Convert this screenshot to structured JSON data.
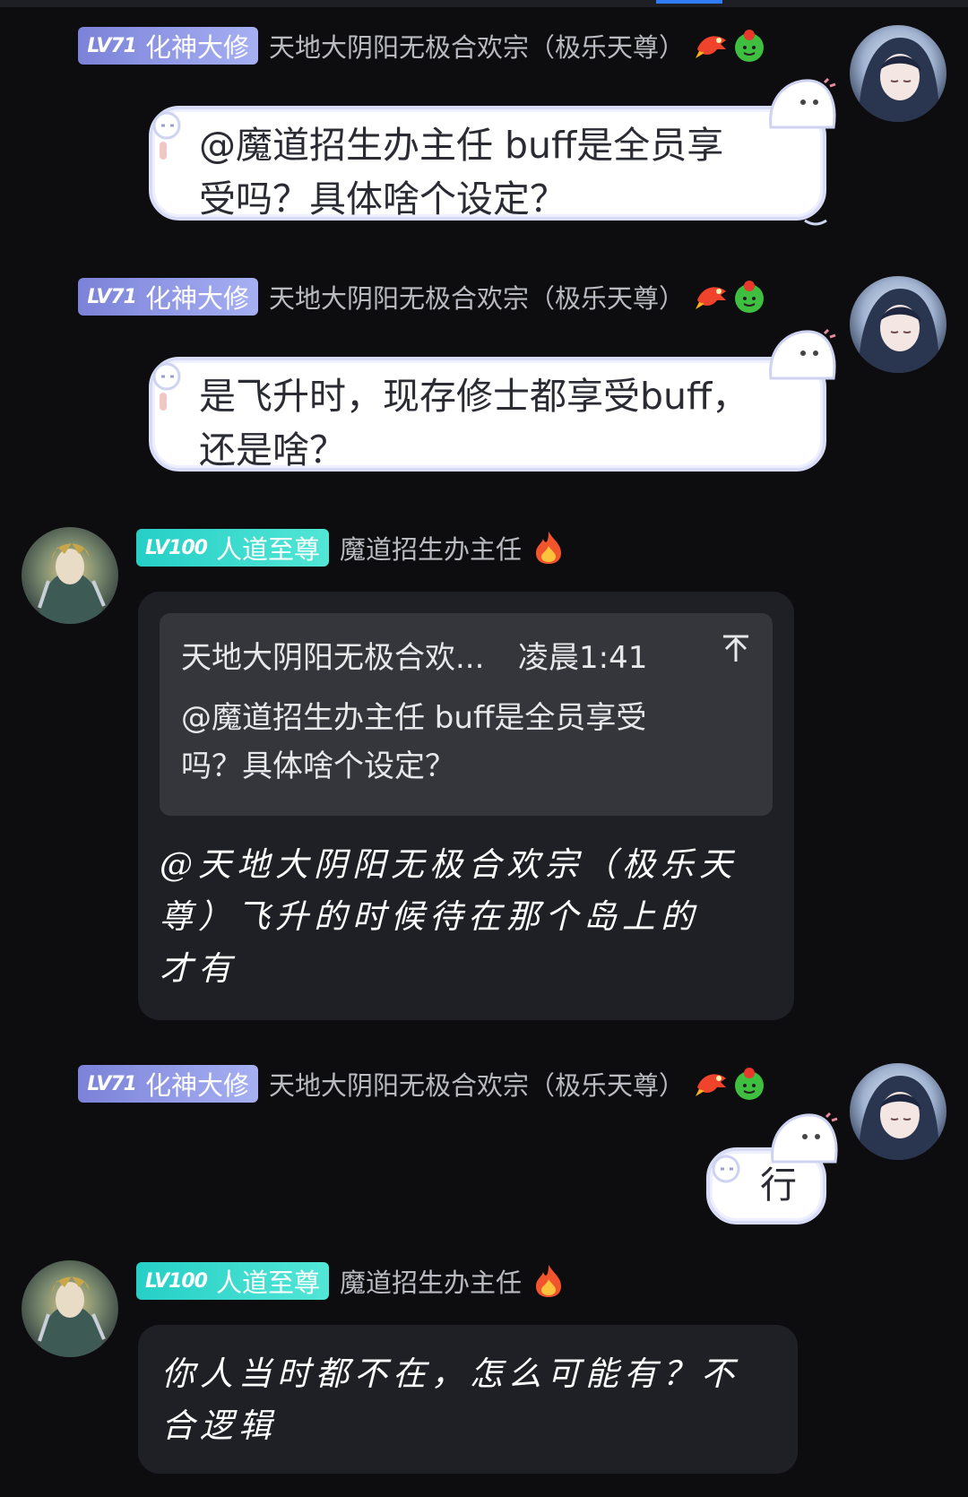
{
  "users": {
    "a": {
      "level": "LV71",
      "title": "化神大修",
      "name": "天地大阴阳无极合欢宗（极乐天尊）",
      "badge_color": "#8e96e4",
      "avatar_icon": "anime-girl-avatar",
      "emojis": [
        "dragon-emoji",
        "melon-emoji"
      ]
    },
    "b": {
      "level": "LV100",
      "title": "人道至尊",
      "name": "魔道招生办主任",
      "badge_color": "#2fd8cc",
      "avatar_icon": "figure-avatar",
      "emojis": [
        "fire-emoji"
      ]
    }
  },
  "messages": [
    {
      "sender": "a",
      "text_line1": "@魔道招生办主任 buff是全员享",
      "text_line2": "受吗？具体啥个设定？"
    },
    {
      "sender": "a",
      "text_line1": "是飞升时，现存修士都享受buff，",
      "text_line2": "还是啥？"
    },
    {
      "sender": "b",
      "quote": {
        "author": "天地大阴阳无极合欢...",
        "time": "凌晨1:41",
        "line1": "@魔道招生办主任 buff是全员享受",
        "line2": "吗？具体啥个设定？",
        "icon": "jump-to-top-icon"
      },
      "text_line1": "@天地大阴阳无极合欢宗（极乐天",
      "text_line2": "尊）飞升的时候待在那个岛上的",
      "text_line3": "才有"
    },
    {
      "sender": "a",
      "text": "行"
    },
    {
      "sender": "b",
      "text_line1": "你人当时都不在，怎么可能有？不",
      "text_line2": "合逻辑"
    }
  ]
}
